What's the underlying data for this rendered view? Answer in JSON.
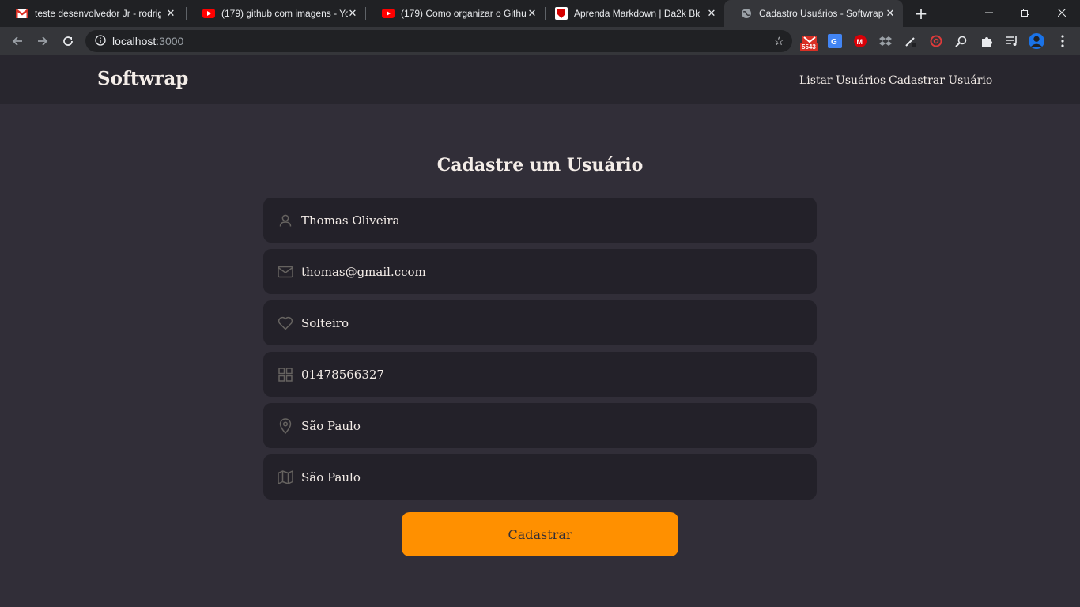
{
  "browser": {
    "tabs": [
      {
        "title": "teste desenvolvedor Jr - rodrigo",
        "favicon": "gmail-icon"
      },
      {
        "title": "(179) github com imagens - YouTube",
        "favicon": "youtube-icon"
      },
      {
        "title": "(179) Como organizar o Github",
        "favicon": "youtube-icon"
      },
      {
        "title": "Aprenda Markdown | Da2k Blog",
        "favicon": "da2k-icon"
      },
      {
        "title": "Cadastro Usuários - Softwrap",
        "favicon": "globe-icon"
      }
    ],
    "url_host": "localhost",
    "url_port": ":3000",
    "ext_badge": "5543"
  },
  "header": {
    "brand": "Softwrap",
    "nav": [
      "Listar Usuários",
      "Cadastrar Usuário"
    ]
  },
  "form": {
    "title": "Cadastre um Usuário",
    "fields": [
      {
        "icon": "user-icon",
        "value": "Thomas Oliveira"
      },
      {
        "icon": "mail-icon",
        "value": "thomas@gmail.ccom"
      },
      {
        "icon": "heart-icon",
        "value": "Solteiro"
      },
      {
        "icon": "grid-icon",
        "value": "01478566327"
      },
      {
        "icon": "map-pin-icon",
        "value": "São Paulo"
      },
      {
        "icon": "map-icon",
        "value": "São Paulo"
      }
    ],
    "submit_label": "Cadastrar"
  },
  "colors": {
    "background": "#312e38",
    "header": "#28262e",
    "input": "#232129",
    "accent": "#ff9000",
    "text": "#f4ede8",
    "icon": "#666360"
  }
}
